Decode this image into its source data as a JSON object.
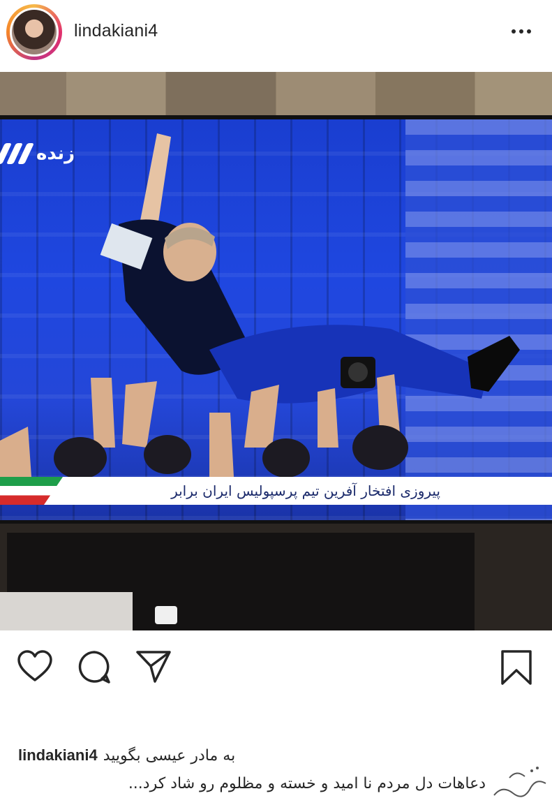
{
  "header": {
    "username": "lindakiani4"
  },
  "photo": {
    "live_label": "زنده",
    "ticker_text": "پیروزی افتخار آفرین تیم پرسپولیس ایران برابر"
  },
  "caption": {
    "username": "lindakiani4",
    "line1": "به مادر عیسی بگویید",
    "line2": "دعاهات دل مردم نا امید و خسته و مظلوم رو شاد کرد..."
  },
  "icons": {
    "like": "heart-icon",
    "comment": "comment-icon",
    "share": "send-icon",
    "save": "bookmark-icon",
    "more": "more-dots-icon"
  },
  "colors": {
    "text": "#262626",
    "screen_blue": "#1f47e0"
  }
}
